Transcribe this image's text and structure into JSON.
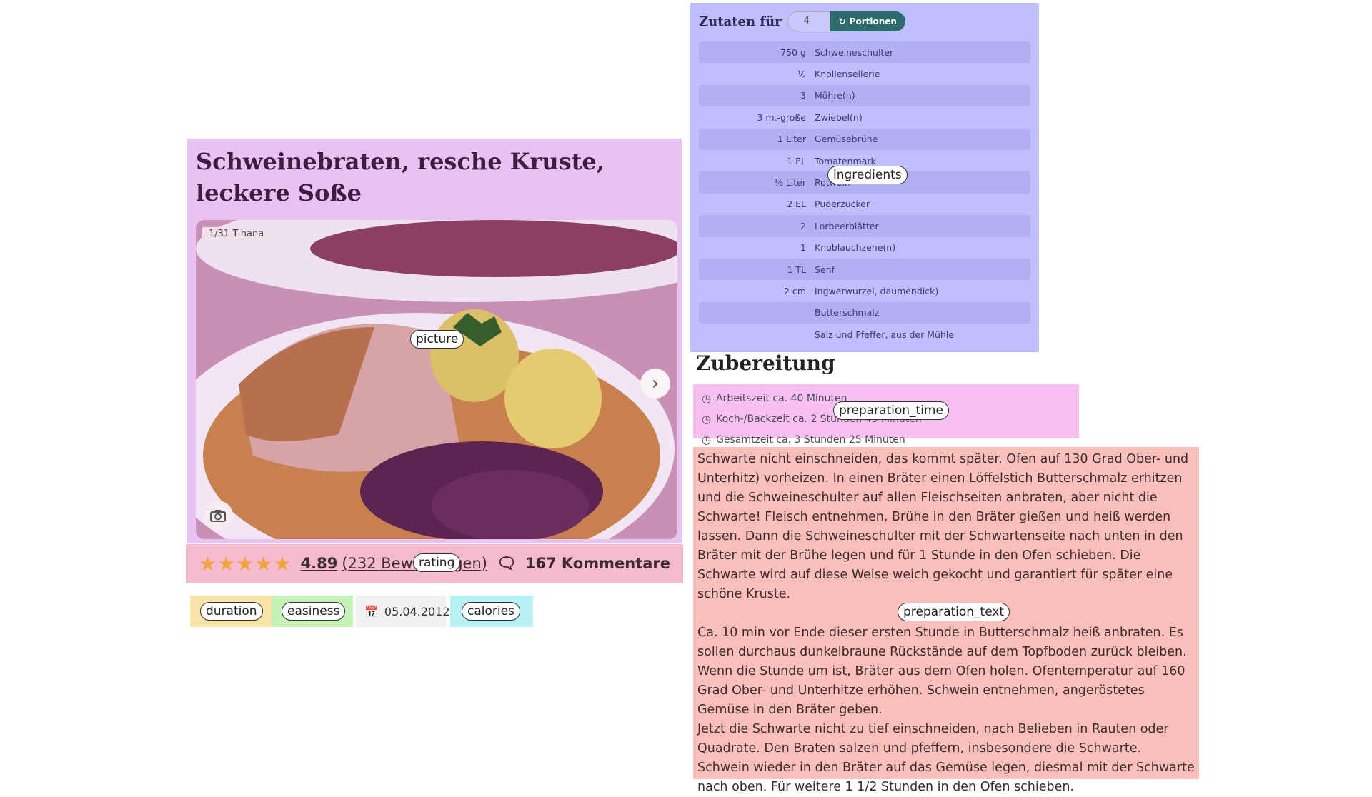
{
  "recipe": {
    "title": "Schweinebraten, resche Kruste, leckere Soße",
    "picture": {
      "credit": "1/31 T-hana",
      "next_icon": "chevron-right-icon",
      "camera_icon": "camera-icon"
    },
    "rating": {
      "stars": "★★★★★",
      "value": "4.89",
      "count_text": "(232 Bewertungen)",
      "comments": "167 Kommentare"
    },
    "badges": {
      "date": "05.04.2012"
    },
    "ingredients": {
      "title": "Zutaten für",
      "servings": "4",
      "button": "Portionen",
      "items": [
        {
          "amount": "750 g",
          "name": "Schweineschulter"
        },
        {
          "amount": "½",
          "name": "Knollensellerie"
        },
        {
          "amount": "3",
          "name": "Möhre(n)"
        },
        {
          "amount": "3 m.-große",
          "name": "Zwiebel(n)"
        },
        {
          "amount": "1 Liter",
          "name": "Gemüsebrühe"
        },
        {
          "amount": "1 EL",
          "name": "Tomatenmark"
        },
        {
          "amount": "⅛ Liter",
          "name": "Rotwein"
        },
        {
          "amount": "2 EL",
          "name": "Puderzucker"
        },
        {
          "amount": "2",
          "name": "Lorbeerblätter"
        },
        {
          "amount": "1",
          "name": "Knoblauchzehe(n)"
        },
        {
          "amount": "1 TL",
          "name": "Senf"
        },
        {
          "amount": "2 cm",
          "name": "Ingwerwurzel, daumendick)"
        },
        {
          "amount": "",
          "name": "Butterschmalz"
        },
        {
          "amount": "",
          "name": "Salz und Pfeffer, aus der Mühle"
        }
      ]
    },
    "preparation": {
      "heading": "Zubereitung",
      "times": {
        "work": "Arbeitszeit ca. 40 Minuten",
        "cook": "Koch-/Backzeit ca. 2 Stunden 45 Minuten",
        "total": "Gesamtzeit ca. 3 Stunden 25 Minuten"
      },
      "text_p1": "Schwarte nicht einschneiden, das kommt später. Ofen auf 130 Grad Ober- und Unterhitz) vorheizen. In einen Bräter einen Löffelstich Butterschmalz erhitzen und die Schweineschulter auf allen Fleischseiten anbraten, aber nicht die Schwarte! Fleisch entnehmen, Brühe in den Bräter gießen und heiß werden lassen. Dann die Schweineschulter mit der Schwartenseite nach unten in den Bräter mit der Brühe legen und für 1 Stunde in den Ofen schieben. Die Schwarte wird auf diese Weise weich gekocht und garantiert für später eine schöne Kruste.",
      "text_p2": "Ca. 10 min vor Ende dieser ersten Stunde in Butterschmalz heiß anbraten. Es sollen durchaus dunkelbraune Rückstände auf dem Topfboden zurück bleiben. Wenn die Stunde um ist, Bräter aus dem Ofen holen. Ofentemperatur auf 160 Grad Ober- und Unterhitze erhöhen. Schwein entnehmen, angeröstetes Gemüse in den Bräter geben.\nJetzt die Schwarte nicht zu tief einschneiden, nach Belieben in Rauten oder Quadrate. Den Braten salzen und pfeffern, insbesondere die Schwarte. Schwein wieder in den Bräter auf das Gemüse legen, diesmal mit der Schwarte nach oben. Für weitere 1 1/2 Stunden in den Ofen schieben."
    }
  },
  "annotation_labels": {
    "picture": "picture",
    "rating": "rating",
    "duration": "duration",
    "easiness": "easiness",
    "calories": "calories",
    "ingredients": "ingredients",
    "preparation_time": "preparation_time",
    "preparation_text": "preparation_text"
  },
  "colors": {
    "title_region": "#e8c1f5",
    "rating_region": "#f5bad0",
    "ingredients_region": "#bfbfff",
    "prep_time_region": "#f8bff1",
    "prep_text_region": "#fbbfbb",
    "duration_region": "#f8e4a9",
    "easiness_region": "#c3f1b6",
    "calories_region": "#b6f2f3",
    "star": "#f2a43b",
    "portion_button": "#2c6a6b"
  }
}
